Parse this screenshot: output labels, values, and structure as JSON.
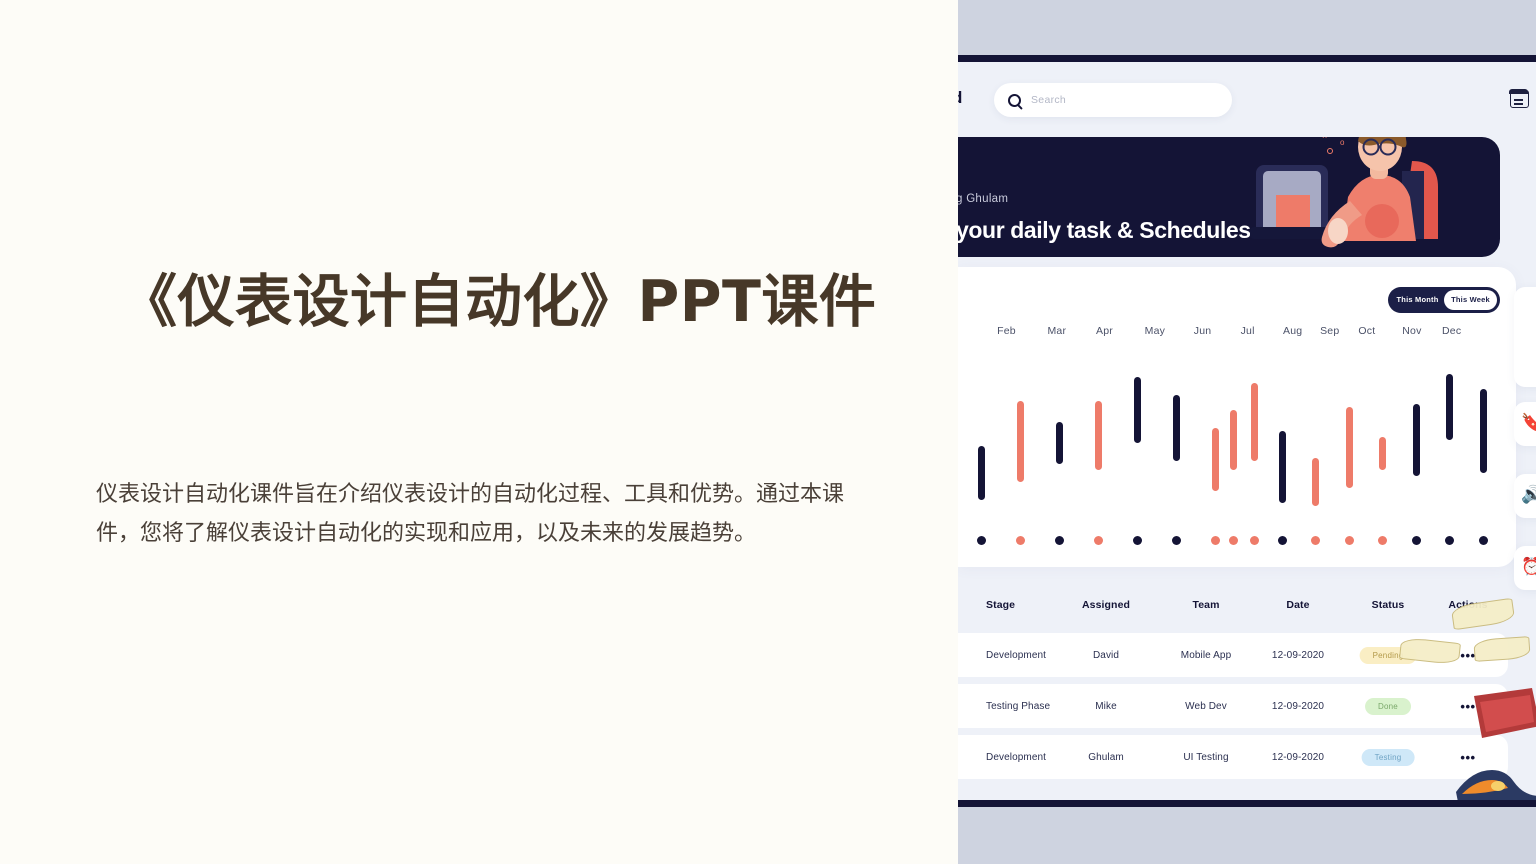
{
  "slide": {
    "title": "《仪表设计自动化》PPT课件",
    "subtitle": "仪表设计自动化课件旨在介绍仪表设计的自动化过程、工具和优势。通过本课件，您将了解仪表设计自动化的实现和应用，以及未来的发展趋势。",
    "title_color": "#473828",
    "background_color": "#fdfcf7"
  },
  "dashboard": {
    "nav_label": "d",
    "search": {
      "placeholder": "Search",
      "icon": "search-icon"
    },
    "calendar_icon": "calendar-icon",
    "hero": {
      "greeting": "g Ghulam",
      "headline": "your daily task & Schedules",
      "background_color": "#141436"
    },
    "chart_card": {
      "toggle": {
        "inactive": "This Month",
        "active": "This Week"
      }
    },
    "table": {
      "headers": [
        "Stage",
        "Assigned",
        "Team",
        "Date",
        "Status",
        "Actions"
      ],
      "rows": [
        {
          "stage": "Development",
          "assigned": "David",
          "team": "Mobile App",
          "date": "12-09-2020",
          "status": "Pending",
          "status_bg": "#faeec4",
          "status_fg": "#b39a4a",
          "actions": "•••"
        },
        {
          "stage": "Testing Phase",
          "assigned": "Mike",
          "team": "Web Dev",
          "date": "12-09-2020",
          "status": "Done",
          "status_bg": "#d9f2cd",
          "status_fg": "#7aa86a",
          "actions": "•••"
        },
        {
          "stage": "Development",
          "assigned": "Ghulam",
          "team": "UI Testing",
          "date": "12-09-2020",
          "status": "Testing",
          "status_bg": "#cfe8f8",
          "status_fg": "#6fa3c4",
          "actions": "•••"
        }
      ]
    },
    "rail_icons": [
      "bookmark-off-icon",
      "megaphone-icon",
      "clock-icon"
    ],
    "colors": {
      "navy": "#141436",
      "coral": "#ee7b69",
      "surface": "#eef1f8",
      "card": "#ffffff"
    }
  },
  "chart_data": {
    "type": "bar",
    "title": "",
    "xlabel": "",
    "ylabel": "",
    "grid": false,
    "legend": "none",
    "ylim": [
      0,
      100
    ],
    "categories": [
      "Feb",
      "Mar",
      "Apr",
      "May",
      "Jun",
      "Jul",
      "Aug",
      "Sep",
      "Oct",
      "Nov",
      "Dec"
    ],
    "tick_positions_pct": [
      6.5,
      16,
      25,
      34.5,
      43.5,
      52,
      60.5,
      67.5,
      74.5,
      83,
      90.5
    ],
    "note": "Floating (low-high) bars, 16 bars alternating navy and coral; each bar has a dot marker at the baseline.",
    "series": [
      {
        "name": "floating-bars",
        "bars": [
          {
            "index": 1,
            "color": "navy",
            "low": 10,
            "high": 46,
            "x_pct": 3.5
          },
          {
            "index": 2,
            "color": "coral",
            "low": 22,
            "high": 76,
            "x_pct": 10.5
          },
          {
            "index": 3,
            "color": "navy",
            "low": 34,
            "high": 62,
            "x_pct": 17.5
          },
          {
            "index": 4,
            "color": "coral",
            "low": 30,
            "high": 76,
            "x_pct": 24.5
          },
          {
            "index": 5,
            "color": "navy",
            "low": 48,
            "high": 92,
            "x_pct": 31.5
          },
          {
            "index": 6,
            "color": "navy",
            "low": 36,
            "high": 80,
            "x_pct": 38.5
          },
          {
            "index": 7,
            "color": "coral",
            "low": 16,
            "high": 58,
            "x_pct": 45.5
          },
          {
            "index": 8,
            "color": "coral",
            "low": 36,
            "high": 88,
            "x_pct": 52.5
          },
          {
            "index": 9,
            "color": "navy",
            "low": 8,
            "high": 56,
            "x_pct": 57.5
          },
          {
            "index": 10,
            "color": "coral",
            "low": 6,
            "high": 38,
            "x_pct": 63.5
          },
          {
            "index": 11,
            "color": "coral",
            "low": 18,
            "high": 72,
            "x_pct": 69.5
          },
          {
            "index": 12,
            "color": "coral",
            "low": 30,
            "high": 52,
            "x_pct": 75.5
          },
          {
            "index": 13,
            "color": "navy",
            "low": 26,
            "high": 74,
            "x_pct": 81.5
          },
          {
            "index": 14,
            "color": "navy",
            "low": 50,
            "high": 94,
            "x_pct": 87.5
          },
          {
            "index": 15,
            "color": "navy",
            "low": 28,
            "high": 84,
            "x_pct": 93.5
          },
          {
            "index": 16,
            "color": "coral",
            "low": 30,
            "high": 70,
            "x_pct": 48.8
          }
        ]
      }
    ]
  }
}
